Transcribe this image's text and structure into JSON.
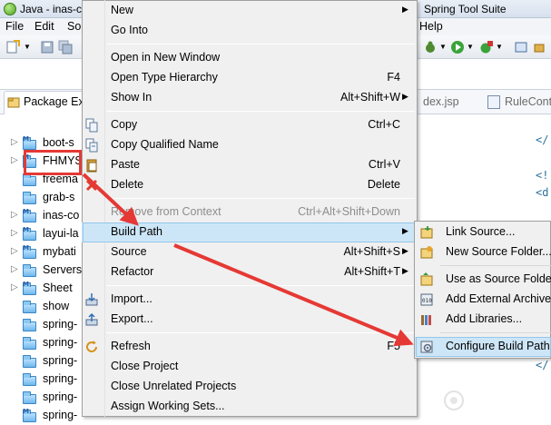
{
  "window": {
    "title_left": "Java - inas-c",
    "title_right": "Spring Tool Suite"
  },
  "menubar": {
    "items": [
      "File",
      "Edit",
      "So",
      "Help"
    ]
  },
  "package_explorer": {
    "tab_label": "Package Ex",
    "items": [
      {
        "label": "boot-s",
        "kind": "project",
        "expandable": true
      },
      {
        "label": "FHMYS",
        "kind": "project",
        "expandable": true
      },
      {
        "label": "freema",
        "kind": "folder",
        "expandable": false
      },
      {
        "label": "grab-s",
        "kind": "folder",
        "expandable": false
      },
      {
        "label": "inas-co",
        "kind": "project",
        "expandable": true
      },
      {
        "label": "layui-la",
        "kind": "project",
        "expandable": true
      },
      {
        "label": "mybati",
        "kind": "project",
        "expandable": true
      },
      {
        "label": "Servers",
        "kind": "folder",
        "expandable": true
      },
      {
        "label": "Sheet",
        "kind": "project",
        "expandable": true
      },
      {
        "label": "show",
        "kind": "folder",
        "expandable": false
      },
      {
        "label": "spring-",
        "kind": "folder",
        "expandable": false
      },
      {
        "label": "spring-",
        "kind": "folder",
        "expandable": false
      },
      {
        "label": "spring-",
        "kind": "folder",
        "expandable": false
      },
      {
        "label": "spring-",
        "kind": "folder",
        "expandable": false
      },
      {
        "label": "spring-",
        "kind": "folder",
        "expandable": false
      },
      {
        "label": "spring-",
        "kind": "project",
        "expandable": false
      }
    ]
  },
  "editor": {
    "tabs": [
      "dex.jsp",
      "RuleCont"
    ],
    "code_fragments": [
      "</",
      "<!",
      "<d",
      "</"
    ]
  },
  "context_menu": {
    "items": [
      {
        "label": "New",
        "shortcut": "",
        "submenu": true,
        "icon": ""
      },
      {
        "label": "Go Into",
        "shortcut": "",
        "submenu": false,
        "icon": ""
      },
      {
        "separator": true
      },
      {
        "label": "Open in New Window",
        "shortcut": "",
        "submenu": false,
        "icon": ""
      },
      {
        "label": "Open Type Hierarchy",
        "shortcut": "F4",
        "submenu": false,
        "icon": ""
      },
      {
        "label": "Show In",
        "shortcut": "Alt+Shift+W",
        "submenu": true,
        "icon": ""
      },
      {
        "separator": true
      },
      {
        "label": "Copy",
        "shortcut": "Ctrl+C",
        "submenu": false,
        "icon": "copy-icon"
      },
      {
        "label": "Copy Qualified Name",
        "shortcut": "",
        "submenu": false,
        "icon": "copy-qualified-icon"
      },
      {
        "label": "Paste",
        "shortcut": "Ctrl+V",
        "submenu": false,
        "icon": "paste-icon"
      },
      {
        "label": "Delete",
        "shortcut": "Delete",
        "submenu": false,
        "icon": "delete-icon"
      },
      {
        "separator": true
      },
      {
        "label": "Remove from Context",
        "shortcut": "Ctrl+Alt+Shift+Down",
        "submenu": false,
        "icon": "",
        "disabled": true
      },
      {
        "label": "Build Path",
        "shortcut": "",
        "submenu": true,
        "icon": "",
        "highlighted": true
      },
      {
        "label": "Source",
        "shortcut": "Alt+Shift+S",
        "submenu": true,
        "icon": ""
      },
      {
        "label": "Refactor",
        "shortcut": "Alt+Shift+T",
        "submenu": true,
        "icon": ""
      },
      {
        "separator": true
      },
      {
        "label": "Import...",
        "shortcut": "",
        "submenu": false,
        "icon": "import-icon"
      },
      {
        "label": "Export...",
        "shortcut": "",
        "submenu": false,
        "icon": "export-icon"
      },
      {
        "separator": true
      },
      {
        "label": "Refresh",
        "shortcut": "F5",
        "submenu": false,
        "icon": "refresh-icon"
      },
      {
        "label": "Close Project",
        "shortcut": "",
        "submenu": false,
        "icon": ""
      },
      {
        "label": "Close Unrelated Projects",
        "shortcut": "",
        "submenu": false,
        "icon": ""
      },
      {
        "label": "Assign Working Sets...",
        "shortcut": "",
        "submenu": false,
        "icon": ""
      }
    ]
  },
  "build_path_submenu": {
    "items": [
      {
        "label": "Link Source...",
        "icon": "link-source-icon"
      },
      {
        "label": "New Source Folder...",
        "icon": "new-source-folder-icon"
      },
      {
        "separator": true
      },
      {
        "label": "Use as Source Folder",
        "icon": "use-as-source-icon"
      },
      {
        "label": "Add External Archives...",
        "icon": "external-archive-icon"
      },
      {
        "label": "Add Libraries...",
        "icon": "library-icon"
      },
      {
        "separator": true
      },
      {
        "label": "Configure Build Path...",
        "icon": "configure-build-path-icon",
        "highlighted": true
      }
    ]
  },
  "colors": {
    "menu_bg": "#f0f0f0",
    "hover_bg": "#cde6f7",
    "annotation_red": "#e53935"
  }
}
